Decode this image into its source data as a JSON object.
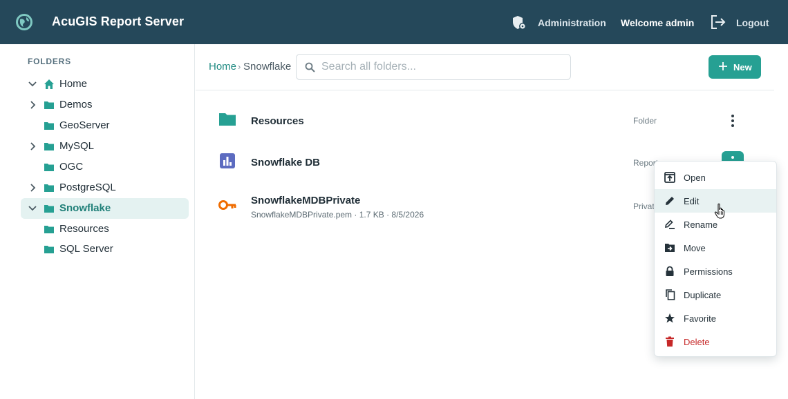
{
  "header": {
    "app_title": "AcuGIS Report Server",
    "admin_label": "Administration",
    "welcome_text": "Welcome admin",
    "logout_label": "Logout",
    "icons": [
      "globe-icon",
      "admin-shield-icon",
      "logout-icon"
    ]
  },
  "sidebar": {
    "heading": "FOLDERS",
    "items": [
      {
        "label": "Home",
        "icon": "home-icon",
        "chevron": "down"
      },
      {
        "label": "Demos",
        "icon": "folder-icon",
        "chevron": "right"
      },
      {
        "label": "GeoServer",
        "icon": "folder-icon",
        "chevron": "none"
      },
      {
        "label": "MySQL",
        "icon": "folder-icon",
        "chevron": "right"
      },
      {
        "label": "OGC",
        "icon": "folder-icon",
        "chevron": "none"
      },
      {
        "label": "PostgreSQL",
        "icon": "folder-icon",
        "chevron": "right"
      },
      {
        "label": "Snowflake",
        "icon": "folder-icon",
        "chevron": "down",
        "selected": true
      },
      {
        "label": "Resources",
        "icon": "folder-icon",
        "chevron": "none"
      },
      {
        "label": "SQL Server",
        "icon": "folder-icon",
        "chevron": "none"
      }
    ]
  },
  "breadcrumb": {
    "home": "Home",
    "separator": "›",
    "current": "Snowflake"
  },
  "search": {
    "placeholder": "Search all folders...",
    "value": ""
  },
  "toolbar": {
    "new_label": "New"
  },
  "items": [
    {
      "name": "Resources",
      "type": "Folder",
      "icon": "folder-icon",
      "meta": ""
    },
    {
      "name": "Snowflake DB",
      "type": "Report",
      "icon": "report-chart-icon",
      "meta": ""
    },
    {
      "name": "SnowflakeMDBPrivate",
      "type": "Private",
      "icon": "key-icon",
      "meta": "SnowflakeMDBPrivate.pem · 1.7 KB · 8/5/2026"
    }
  ],
  "context_menu": {
    "items": [
      {
        "label": "Open",
        "icon": "open-icon"
      },
      {
        "label": "Edit",
        "icon": "pencil-icon",
        "hover": true
      },
      {
        "label": "Rename",
        "icon": "rename-icon"
      },
      {
        "label": "Move",
        "icon": "move-folder-icon"
      },
      {
        "label": "Permissions",
        "icon": "lock-icon"
      },
      {
        "label": "Duplicate",
        "icon": "duplicate-icon"
      },
      {
        "label": "Favorite",
        "icon": "star-icon"
      },
      {
        "label": "Delete",
        "icon": "trash-icon",
        "danger": true
      }
    ]
  },
  "colors": {
    "header_bg": "#25485a",
    "accent": "#26a093",
    "selected_bg": "#e4f2f1",
    "danger": "#c62828",
    "key_icon": "#ef6c00",
    "report_icon": "#5c6bc0"
  }
}
